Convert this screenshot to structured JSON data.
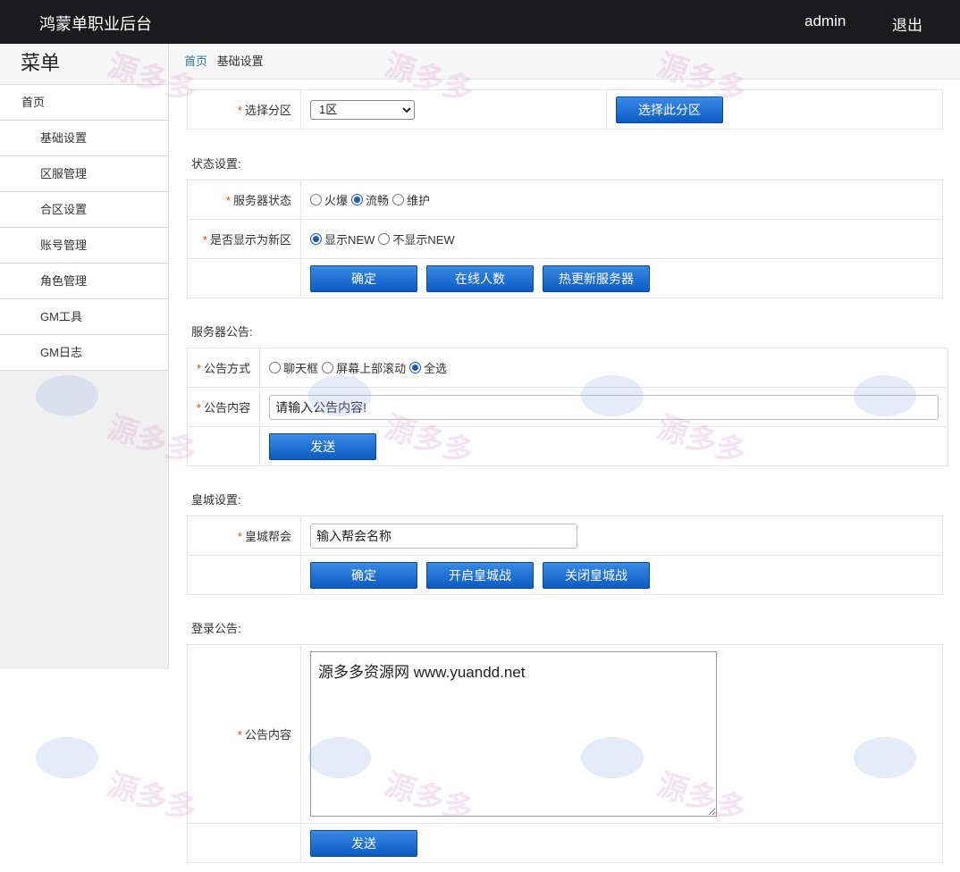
{
  "header": {
    "title": "鸿蒙单职业后台",
    "user": "admin",
    "logout": "退出"
  },
  "sidebar": {
    "menu_title": "菜单",
    "home": "首页",
    "items": [
      "基础设置",
      "区服管理",
      "合区设置",
      "账号管理",
      "角色管理",
      "GM工具",
      "GM日志"
    ]
  },
  "breadcrumb": {
    "home": "首页",
    "current": "基础设置"
  },
  "zone": {
    "label": "选择分区",
    "selected": "1区",
    "button": "选择此分区"
  },
  "status": {
    "section": "状态设置:",
    "server_label": "服务器状态",
    "server_options": [
      "火爆",
      "流畅",
      "维护"
    ],
    "new_label": "是否显示为新区",
    "new_options": [
      "显示NEW",
      "不显示NEW"
    ],
    "buttons": [
      "确定",
      "在线人数",
      "热更新服务器"
    ]
  },
  "notice": {
    "section": "服务器公告:",
    "mode_label": "公告方式",
    "mode_options": [
      "聊天框",
      "屏幕上部滚动",
      "全选"
    ],
    "content_label": "公告内容",
    "content_value": "请输入公告内容!",
    "send": "发送"
  },
  "castle": {
    "section": "皇城设置:",
    "guild_label": "皇城帮会",
    "guild_value": "输入帮会名称",
    "buttons": [
      "确定",
      "开启皇城战",
      "关闭皇城战"
    ]
  },
  "login_notice": {
    "section": "登录公告:",
    "content_label": "公告内容",
    "content_value": "源多多资源网 www.yuandd.net",
    "send": "发送"
  },
  "watermark": {
    "text": "源多多"
  }
}
